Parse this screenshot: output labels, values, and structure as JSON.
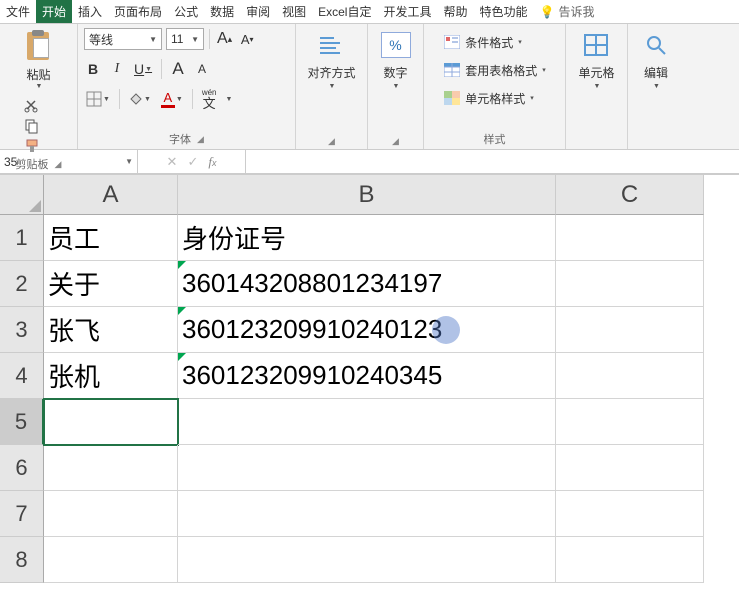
{
  "tabs": {
    "items": [
      "文件",
      "开始",
      "插入",
      "页面布局",
      "公式",
      "数据",
      "审阅",
      "视图",
      "Excel自定",
      "开发工具",
      "帮助",
      "特色功能"
    ],
    "active_index": 1,
    "tell_me": "告诉我"
  },
  "ribbon": {
    "clipboard": {
      "paste": "粘贴",
      "label": "剪贴板"
    },
    "font": {
      "name": "等线",
      "size": "11",
      "bold": "B",
      "italic": "I",
      "underline": "U",
      "grow": "A",
      "shrink": "A",
      "wen": "wén\n文",
      "label": "字体"
    },
    "alignment": {
      "button": "对齐方式"
    },
    "number": {
      "button": "数字",
      "symbol": "%"
    },
    "styles": {
      "cond": "条件格式",
      "table": "套用表格格式",
      "cell": "单元格样式",
      "label": "样式"
    },
    "cells": {
      "button": "单元格"
    },
    "editing": {
      "button": "编辑"
    }
  },
  "formula_bar": {
    "name_box": "35",
    "formula": ""
  },
  "grid": {
    "columns": [
      "A",
      "B",
      "C"
    ],
    "rows": [
      "1",
      "2",
      "3",
      "4",
      "5",
      "6",
      "7",
      "8"
    ],
    "data": {
      "A1": "员工",
      "B1": "身份证号",
      "A2": "关于",
      "B2": "360143208801234197",
      "A3": "张飞",
      "B3": "360123209910240123",
      "A4": "张机",
      "B4": "360123209910240345"
    },
    "selected_row": 5
  }
}
